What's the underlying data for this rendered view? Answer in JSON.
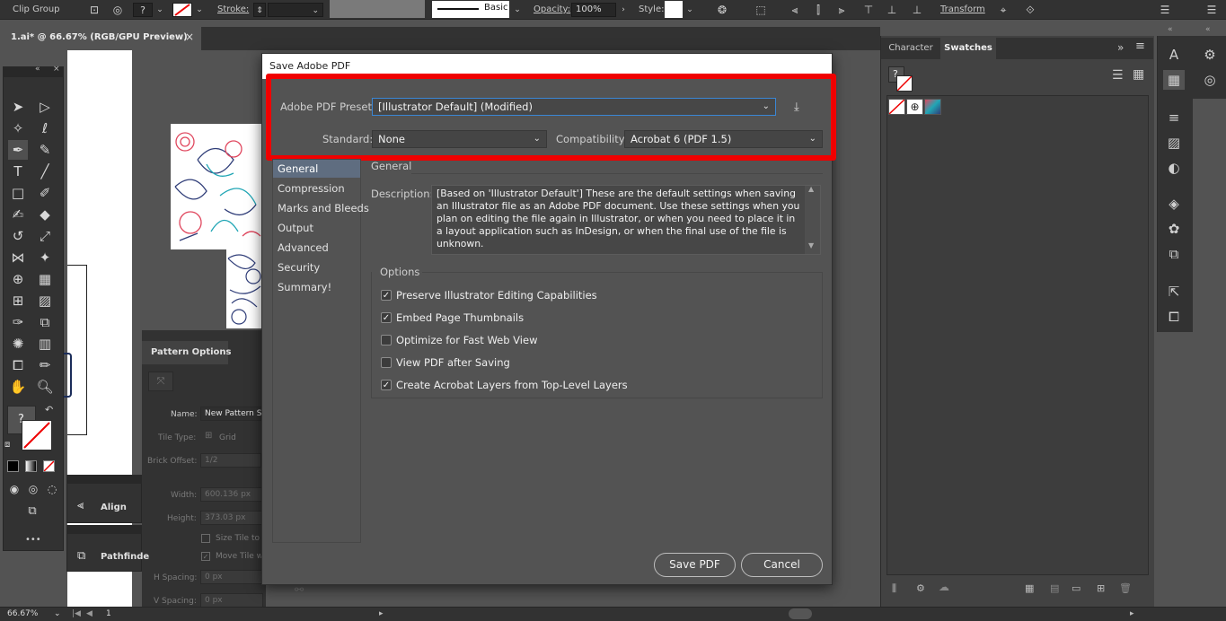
{
  "control_bar": {
    "object_type": "Clip Group",
    "stroke_label": "Stroke:",
    "brush_label": "Basic",
    "opacity_label": "Opacity:",
    "opacity_value": "100%",
    "style_label": "Style:",
    "transform_label": "Transform"
  },
  "document_tab": {
    "title": "1.ai* @ 66.67% (RGB/GPU Preview)",
    "close_glyph": "×"
  },
  "tools_panel": {
    "fill_stroke_unknown": "?",
    "more_tools": "•••"
  },
  "pattern_options": {
    "title": "Pattern Options",
    "name_label": "Name:",
    "name_value": "New Pattern S",
    "tile_type_label": "Tile Type:",
    "tile_type_value": "Grid",
    "brick_offset_label": "Brick Offset:",
    "brick_offset_value": "1/2",
    "width_label": "Width:",
    "width_value": "600.136 px",
    "height_label": "Height:",
    "height_value": "373.03 px",
    "size_tile_label": "Size Tile to",
    "move_tile_label": "Move Tile w",
    "h_spacing_label": "H Spacing:",
    "h_spacing_value": "0 px",
    "v_spacing_label": "V Spacing:",
    "v_spacing_value": "0 px"
  },
  "align_panel": {
    "title": "Align"
  },
  "pathfinder_panel": {
    "title": "Pathfinde"
  },
  "right_panel": {
    "tabs": [
      {
        "label": "Character",
        "active": false
      },
      {
        "label": "Swatches",
        "active": true
      }
    ],
    "collapse_glyph": "»",
    "menu_glyph": "≡",
    "swatch_unknown": "?"
  },
  "status_bar": {
    "zoom": "66.67%",
    "page": "1"
  },
  "dialog": {
    "title": "Save Adobe PDF",
    "preset_label": "Adobe PDF Preset:",
    "preset_value": "[Illustrator Default] (Modified)",
    "standard_label": "Standard:",
    "standard_value": "None",
    "compatibility_label": "Compatibility:",
    "compatibility_value": "Acrobat 6 (PDF 1.5)",
    "nav_items": [
      {
        "label": "General",
        "selected": true
      },
      {
        "label": "Compression",
        "selected": false
      },
      {
        "label": "Marks and Bleeds",
        "selected": false
      },
      {
        "label": "Output",
        "selected": false
      },
      {
        "label": "Advanced",
        "selected": false
      },
      {
        "label": "Security",
        "selected": false
      },
      {
        "label": "Summary!",
        "selected": false
      }
    ],
    "section_title": "General",
    "description_label": "Description:",
    "description_text": "[Based on 'Illustrator Default'] These are the default settings when saving an Illustrator file as an Adobe PDF document. Use these settings when you plan on editing the file again in Illustrator, or when you need to place it in a layout application such as InDesign, or when the final use of the file is unknown.",
    "options_title": "Options",
    "options": [
      {
        "label": "Preserve Illustrator Editing Capabilities",
        "checked": true
      },
      {
        "label": "Embed Page Thumbnails",
        "checked": true
      },
      {
        "label": "Optimize for Fast Web View",
        "checked": false
      },
      {
        "label": "View PDF after Saving",
        "checked": false
      },
      {
        "label": "Create Acrobat Layers from Top-Level Layers",
        "checked": true
      }
    ],
    "save_button": "Save PDF",
    "cancel_button": "Cancel"
  },
  "colors": {
    "highlight": "#f00000",
    "accent_blue": "#3a86d4",
    "selection": "#5f6d80"
  }
}
